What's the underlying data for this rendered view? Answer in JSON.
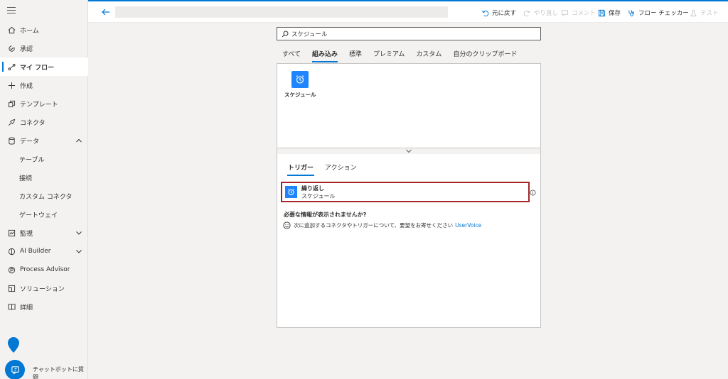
{
  "sidebar": {
    "items": [
      {
        "label": "ホーム"
      },
      {
        "label": "承認"
      },
      {
        "label": "マイ フロー"
      },
      {
        "label": "作成"
      },
      {
        "label": "テンプレート"
      },
      {
        "label": "コネクタ"
      },
      {
        "label": "データ"
      },
      {
        "label": "テーブル"
      },
      {
        "label": "接続"
      },
      {
        "label": "カスタム コネクタ"
      },
      {
        "label": "ゲートウェイ"
      },
      {
        "label": "監視"
      },
      {
        "label": "AI Builder"
      },
      {
        "label": "Process Advisor"
      },
      {
        "label": "ソリューション"
      },
      {
        "label": "詳細"
      }
    ],
    "chatbot_label": "チャットボットに質問"
  },
  "toolbar": {
    "undo": "元に戻す",
    "redo": "やり直し",
    "comment": "コメント",
    "save": "保存",
    "flow_checker": "フロー チェッカー",
    "test": "テスト"
  },
  "search": {
    "value": "スケジュール"
  },
  "tabs": [
    "すべて",
    "組み込み",
    "標準",
    "プレミアム",
    "カスタム",
    "自分のクリップボード"
  ],
  "connector": {
    "label": "スケジュール"
  },
  "sub_tabs": [
    "トリガー",
    "アクション"
  ],
  "trigger": {
    "title": "繰り返し",
    "subtitle": "スケジュール"
  },
  "missing": {
    "title": "必要な情報が表示されませんか?",
    "text": "次に追加するコネクタやトリガーについて、要望をお寄せください",
    "link": "UserVoice"
  },
  "colors": {
    "accent": "#0078d4",
    "tile": "#1f85ff",
    "highlight": "#a4262c"
  }
}
